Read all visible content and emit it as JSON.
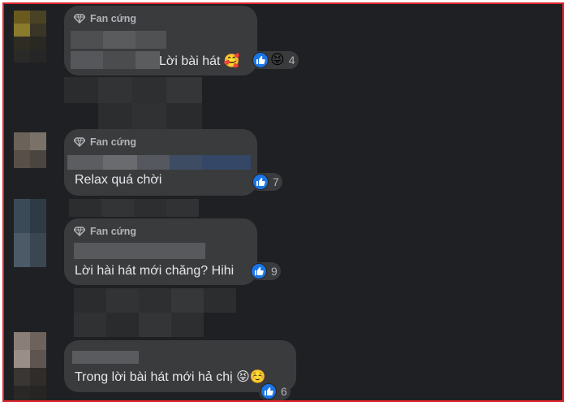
{
  "comments": [
    {
      "badge": "Fan cứng",
      "text": "Lời bài hát 🥰",
      "reaction_count": "4",
      "reactions": [
        "like-icon",
        "laugh-icon"
      ]
    },
    {
      "badge": "Fan cứng",
      "text": "Relax quá chời",
      "reaction_count": "7",
      "reactions": [
        "like-icon"
      ]
    },
    {
      "badge": "Fan cứng",
      "text": "Lời hài hát mới chăng? Hihi",
      "reaction_count": "9",
      "reactions": [
        "like-icon"
      ]
    },
    {
      "badge": "",
      "text": "Trong lời bài hát mới hả chị 😝☺️",
      "reaction_count": "6",
      "reactions": [
        "like-icon"
      ]
    }
  ],
  "colors": {
    "frame_border": "#e0262d",
    "background": "#1f2023",
    "bubble": "#3a3b3c",
    "text": "#e4e6eb",
    "meta_text": "#b0b3b8",
    "like_blue": "#1b74e4"
  }
}
